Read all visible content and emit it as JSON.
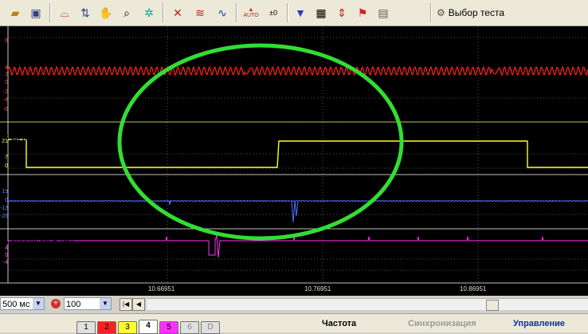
{
  "toolbar": {
    "test_select_label": "Выбор теста",
    "icons": [
      "open-folder-icon",
      "save-icon",
      "trigger-icon",
      "cursor-icon",
      "hand-icon",
      "zoom-icon",
      "probe-icon",
      "waves-icon",
      "overlay-icon",
      "filter-icon",
      "auto-icon",
      "offset-icon",
      "channel-filter-icon",
      "grid-icon",
      "split-icon",
      "flag-icon",
      "notes-icon"
    ],
    "auto_label": "AUTO",
    "offset_label": "0"
  },
  "scope": {
    "channels": [
      {
        "label": "2  канал № 2 (В)",
        "color": "#ff2020",
        "ticks": [
          "6",
          "4",
          "2",
          "0",
          "-2",
          "-4",
          "-6"
        ]
      },
      {
        "label": "3 ДПКВ Холла 12В (В)",
        "color": "#ffff30",
        "ticks": [
          "21",
          "7",
          "0"
        ]
      },
      {
        "label": "4  канал № 4 (В)",
        "color": "#5070ff",
        "ticks": [
          "13",
          "0",
          "-13",
          "-26"
        ]
      },
      {
        "label": "5  канал № 5 (В)",
        "color": "#ff30ff",
        "ticks": [
          "4",
          "0",
          "-4"
        ]
      }
    ],
    "x_ticks": [
      "10.66951",
      "10.76951",
      "10.86951"
    ]
  },
  "controls": {
    "timebase_value": "500 мс",
    "zoom_value": "100"
  },
  "bottom": {
    "channel_tabs": [
      "1",
      "2",
      "3",
      "4",
      "5",
      "6",
      "D"
    ],
    "panel_tabs": [
      "Частота",
      "Синхронизация",
      "Управление"
    ]
  }
}
